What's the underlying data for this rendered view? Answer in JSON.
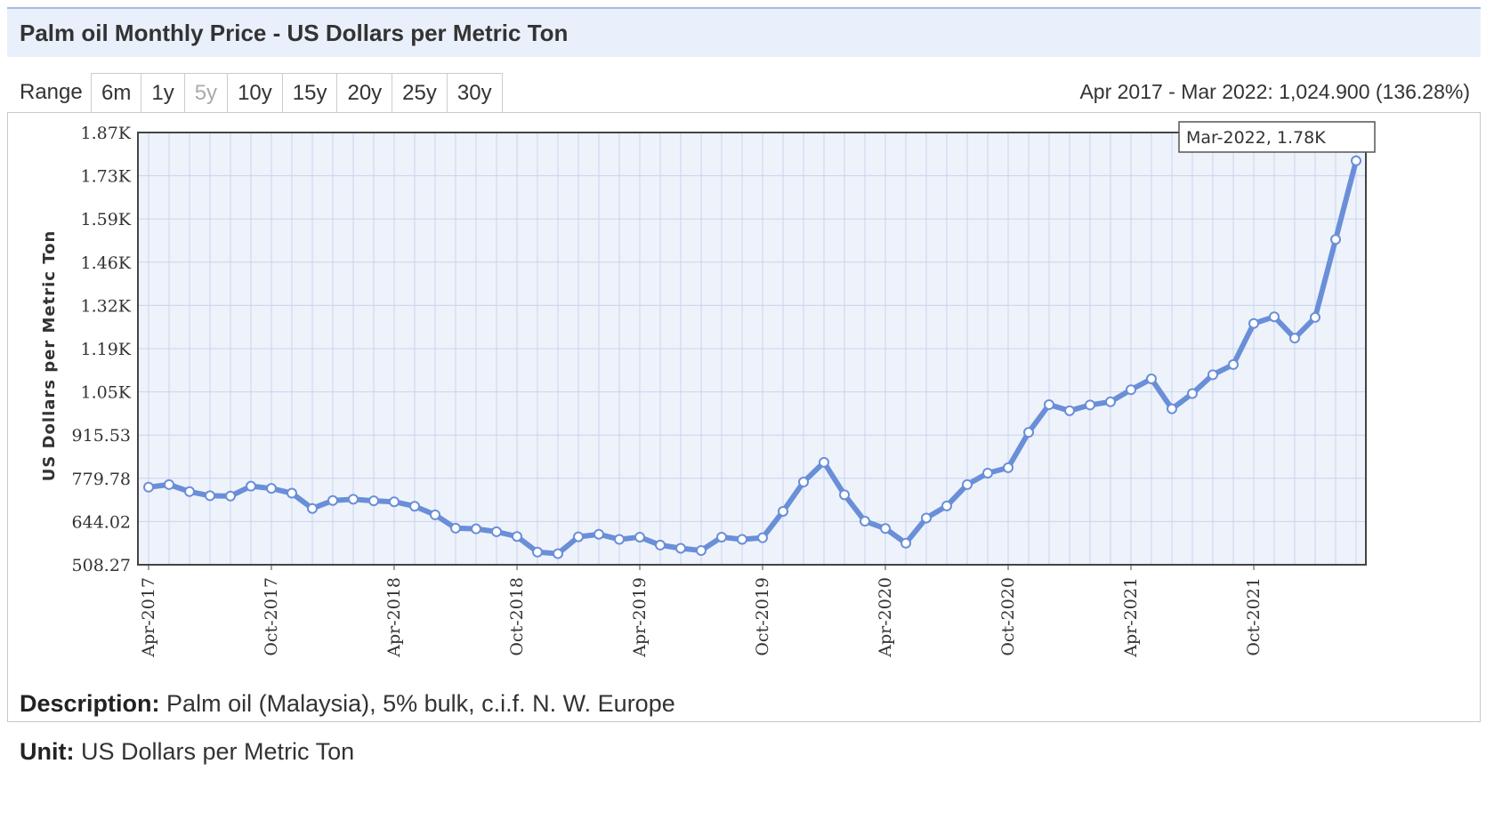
{
  "header": {
    "title": "Palm oil Monthly Price - US Dollars per Metric Ton"
  },
  "range": {
    "label": "Range",
    "buttons": [
      "6m",
      "1y",
      "5y",
      "10y",
      "15y",
      "20y",
      "25y",
      "30y"
    ],
    "active": "5y",
    "summary": "Apr 2017 - Mar 2022: 1,024.900 (136.28%)"
  },
  "tooltip": {
    "text": "Mar-2022, 1.78K"
  },
  "description": {
    "label": "Description:",
    "text": "Palm oil (Malaysia), 5% bulk, c.i.f. N. W. Europe"
  },
  "unit": {
    "label": "Unit:",
    "text": "US Dollars per Metric Ton"
  },
  "colors": {
    "line": "#6a8fd8",
    "plot_bg": "#eef2fb",
    "grid": "#c8d4ec"
  },
  "chart_data": {
    "type": "line",
    "title": "Palm oil Monthly Price - US Dollars per Metric Ton",
    "xlabel": "",
    "ylabel": "US Dollars per Metric Ton",
    "ylim": [
      508.27,
      1865.78
    ],
    "yticks": [
      "508.27",
      "644.02",
      "779.78",
      "915.53",
      "1.05K",
      "1.19K",
      "1.32K",
      "1.46K",
      "1.59K",
      "1.73K",
      "1.87K"
    ],
    "xtick_labels": [
      "Apr-2017",
      "Oct-2017",
      "Apr-2018",
      "Oct-2018",
      "Apr-2019",
      "Oct-2019",
      "Apr-2020",
      "Oct-2020",
      "Apr-2021",
      "Oct-2021"
    ],
    "grid": true,
    "series": [
      {
        "x": [
          "Apr-2017",
          "May-2017",
          "Jun-2017",
          "Jul-2017",
          "Aug-2017",
          "Sep-2017",
          "Oct-2017",
          "Nov-2017",
          "Dec-2017",
          "Jan-2018",
          "Feb-2018",
          "Mar-2018",
          "Apr-2018",
          "May-2018",
          "Jun-2018",
          "Jul-2018",
          "Aug-2018",
          "Sep-2018",
          "Oct-2018",
          "Nov-2018",
          "Dec-2018",
          "Jan-2019",
          "Feb-2019",
          "Mar-2019",
          "Apr-2019",
          "May-2019",
          "Jun-2019",
          "Jul-2019",
          "Aug-2019",
          "Sep-2019",
          "Oct-2019",
          "Nov-2019",
          "Dec-2019",
          "Jan-2020",
          "Feb-2020",
          "Mar-2020",
          "Apr-2020",
          "May-2020",
          "Jun-2020",
          "Jul-2020",
          "Aug-2020",
          "Sep-2020",
          "Oct-2020",
          "Nov-2020",
          "Dec-2020",
          "Jan-2021",
          "Feb-2021",
          "Mar-2021",
          "Apr-2021",
          "May-2021",
          "Jun-2021",
          "Jul-2021",
          "Aug-2021",
          "Sep-2021",
          "Oct-2021",
          "Nov-2021",
          "Dec-2021",
          "Jan-2022",
          "Feb-2022",
          "Mar-2022"
        ],
        "values": [
          752,
          760,
          738,
          725,
          724,
          755,
          748,
          733,
          685,
          710,
          714,
          709,
          706,
          692,
          665,
          623,
          621,
          612,
          597,
          548,
          543,
          596,
          604,
          588,
          595,
          570,
          560,
          553,
          595,
          588,
          593,
          676,
          768,
          830,
          728,
          645,
          622,
          576,
          655,
          693,
          760,
          796,
          813,
          924,
          1011,
          992,
          1010,
          1020,
          1058,
          1092,
          998,
          1046,
          1105,
          1137,
          1266,
          1287,
          1220,
          1285,
          1530,
          1777
        ]
      }
    ]
  }
}
